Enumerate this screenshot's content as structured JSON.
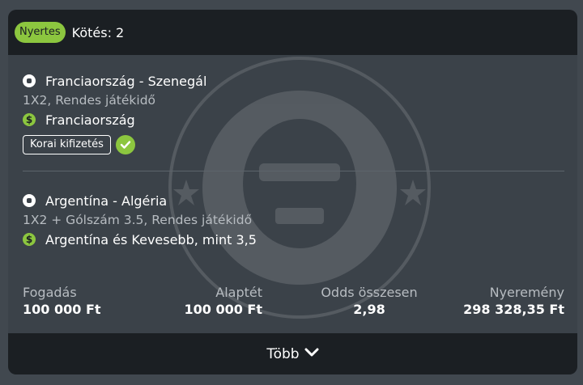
{
  "header": {
    "status_badge": "Nyertes",
    "bets_count": "Kötés: 2"
  },
  "bets": [
    {
      "match": "Franciaország - Szenegál",
      "market": "1X2, Rendes játékidő",
      "pick": "Franciaország",
      "early_payout_label": "Korai kifizetés",
      "icon": "soccer-ball-icon",
      "pick_icon": "dollar-icon"
    },
    {
      "match": "Argentína - Algéria",
      "market": "1X2 + Gólszám 3.5, Rendes játékidő",
      "pick": "Argentína és Kevesebb, mint 3,5",
      "icon": "soccer-ball-icon",
      "pick_icon": "dollar-icon"
    }
  ],
  "summary": {
    "stake_label": "Fogadás",
    "stake_value": "100 000 Ft",
    "base_label": "Alaptét",
    "base_value": "100 000 Ft",
    "odds_label": "Odds összesen",
    "odds_value": "2,98",
    "winnings_label": "Nyeremény",
    "winnings_value": "298 328,35 Ft"
  },
  "footer": {
    "more_label": "Több"
  },
  "colors": {
    "accent": "#8cc63f",
    "card_bg": "#3b4249",
    "dark_bg": "#1b1f23",
    "muted_text": "#b7bcc1"
  }
}
